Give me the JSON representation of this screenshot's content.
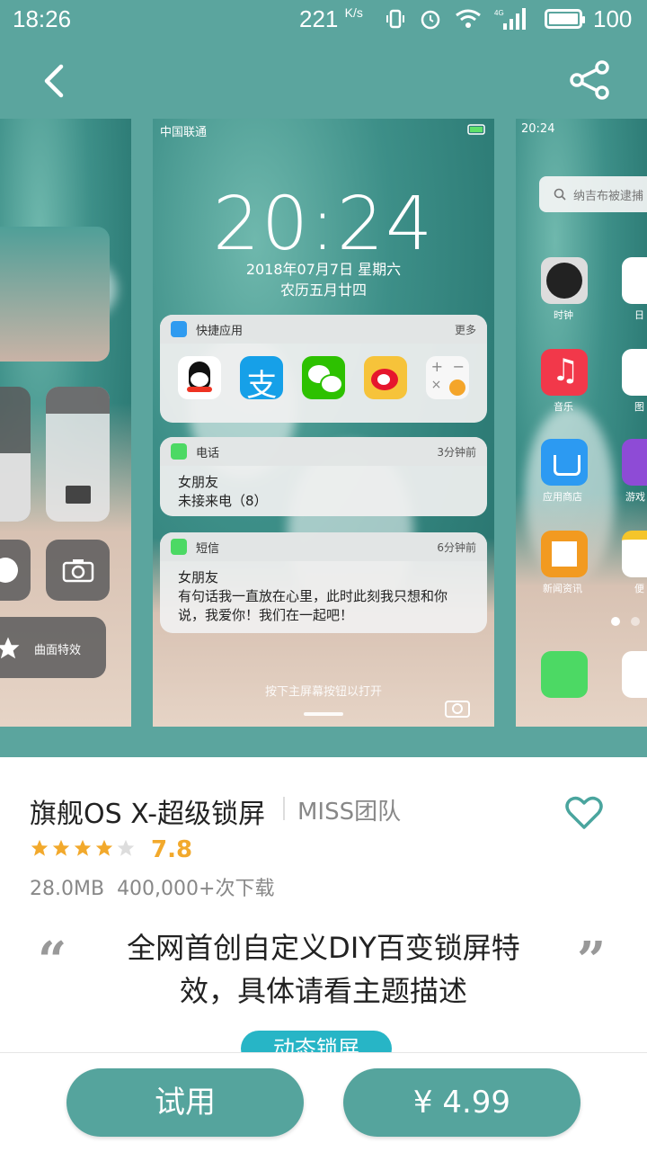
{
  "status_bar": {
    "time": "18:26",
    "speed": "221",
    "speed_unit": "K/s",
    "battery": "100",
    "network": "4G"
  },
  "nav": {
    "back_icon": "chevron-left-icon",
    "share_icon": "share-icon"
  },
  "screenshots": {
    "left": {
      "effect_label": "曲面特效"
    },
    "center": {
      "carrier": "中国联通",
      "clock": "20:24",
      "date": "2018年07月7日 星期六",
      "lunar": "农历五月廿四",
      "quick_apps": {
        "title": "快捷应用",
        "more": "更多"
      },
      "call_card": {
        "app": "电话",
        "time": "3分钟前",
        "name": "女朋友",
        "text": "未接来电（8）"
      },
      "sms_card": {
        "app": "短信",
        "time": "6分钟前",
        "name": "女朋友",
        "text": "有句话我一直放在心里，此时此刻我只想和你说，我爱你！我们在一起吧！"
      },
      "hint": "按下主屏幕按钮以打开"
    },
    "right": {
      "time": "20:24",
      "search_placeholder": "纳吉布被逮捕",
      "apps": [
        "时钟",
        "日",
        "音乐",
        "图",
        "应用商店",
        "游戏",
        "新闻资讯",
        "便"
      ]
    }
  },
  "theme": {
    "title": "旗舰OS X-超级锁屏",
    "team": "MISS团队",
    "rating": "7.8",
    "stars": 4,
    "size": "28.0MB",
    "downloads": "400,000+次下载",
    "description": "全网首创自定义DIY百变锁屏特效，具体请看主题描述",
    "tag": "动态锁屏"
  },
  "actions": {
    "try": "试用",
    "price": "¥ 4.99"
  },
  "colors": {
    "header_bg": "#5ba59e",
    "button_bg": "#55a49d",
    "star": "#f2a92c",
    "tag_bg": "#27b5c6",
    "heart": "#4aa59e"
  }
}
